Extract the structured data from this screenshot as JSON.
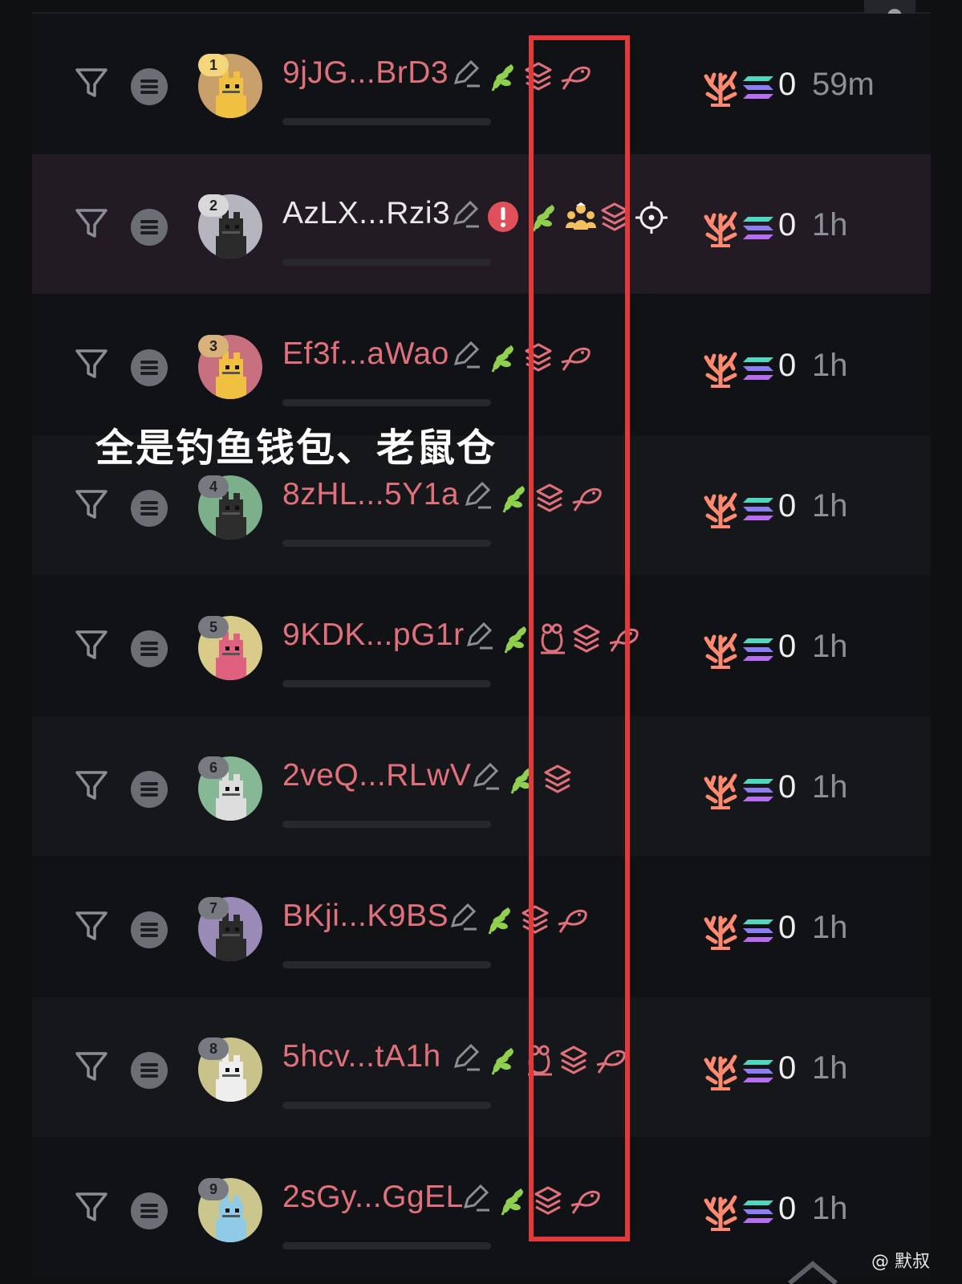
{
  "overlay": {
    "caption": "全是钓鱼钱包、老鼠仓",
    "watermark": "@ 默叔"
  },
  "colors": {
    "name_accent": "#e0707b",
    "highlight_box": "#e23a3a",
    "leaf": "#8fd14f",
    "alert": "#e0505a"
  },
  "wallets": [
    {
      "rank": "1",
      "name": "9jJG...BrD3",
      "count": "0",
      "time": "59m",
      "tags": [
        "leaf-icon",
        "layers-icon",
        "fish-icon"
      ]
    },
    {
      "rank": "2",
      "name": "AzLX...Rzi3",
      "count": "0",
      "time": "1h",
      "tags": [
        "alert-icon",
        "leaf-icon",
        "group-icon",
        "layers-icon",
        "crosshair-icon"
      ]
    },
    {
      "rank": "3",
      "name": "Ef3f...aWao",
      "count": "0",
      "time": "1h",
      "tags": [
        "leaf-icon",
        "layers-icon",
        "fish-icon"
      ]
    },
    {
      "rank": "4",
      "name": "8zHL...5Y1a",
      "count": "0",
      "time": "1h",
      "tags": [
        "leaf-icon",
        "layers-icon",
        "fish-icon"
      ]
    },
    {
      "rank": "5",
      "name": "9KDK...pG1r",
      "count": "0",
      "time": "1h",
      "tags": [
        "leaf-icon",
        "rat-icon",
        "layers-icon",
        "fish-icon"
      ]
    },
    {
      "rank": "6",
      "name": "2veQ...RLwV",
      "count": "0",
      "time": "1h",
      "tags": [
        "leaf-icon",
        "layers-icon"
      ]
    },
    {
      "rank": "7",
      "name": "BKji...K9BS",
      "count": "0",
      "time": "1h",
      "tags": [
        "leaf-icon",
        "layers-icon",
        "fish-icon"
      ]
    },
    {
      "rank": "8",
      "name": "5hcv...tA1h",
      "count": "0",
      "time": "1h",
      "tags": [
        "leaf-icon",
        "rat-icon",
        "layers-icon",
        "fish-icon"
      ]
    },
    {
      "rank": "9",
      "name": "2sGy...GgEL",
      "count": "0",
      "time": "1h",
      "tags": [
        "leaf-icon",
        "layers-icon",
        "fish-icon"
      ]
    }
  ]
}
